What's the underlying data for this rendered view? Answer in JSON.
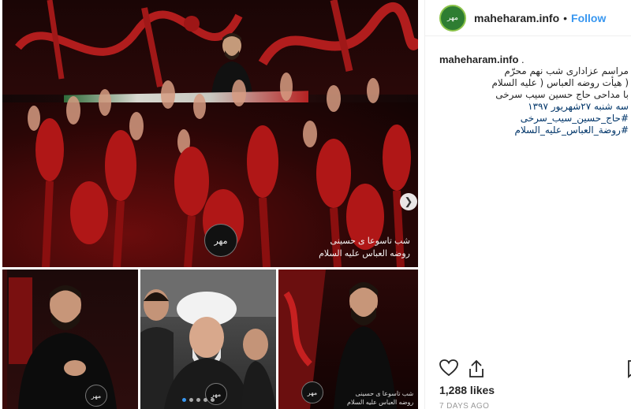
{
  "post": {
    "username": "maheharam.info",
    "separator": "•",
    "follow_label": "Follow",
    "avatar_icon": "avatar-logo-icon",
    "caption": {
      "username": "maheharam.info",
      "username_suffix": " .",
      "lines": [
        "مراسم عزاداری شب نهم محرّم",
        "( هیأت روضه العباس ( علیه السلام",
        "با مداحی حاج حسین سیب سرخی",
        "سه شنبه ۲۷شهریور ۱۳۹۷ #حاج_حسین_سیب_سرخی",
        "#روضة_العباس_علیه_السلام"
      ]
    },
    "likes": "1,288 likes",
    "timestamp": "7 DAYS AGO"
  },
  "media": {
    "main_overlay_line1": "شب تاسوعا ی حسینی",
    "main_overlay_line2": "روضه العباس علیه السلام",
    "logo_text": "مهر",
    "thumb3_caption_line1": "شب تاسوعا ی حسینی",
    "thumb3_caption_line2": "روضه العباس علیه السلام",
    "carousel_dots": 5,
    "active_dot": 0
  },
  "colors": {
    "accent": "#3897f0",
    "hashtag": "#003569",
    "muted": "#999999"
  }
}
